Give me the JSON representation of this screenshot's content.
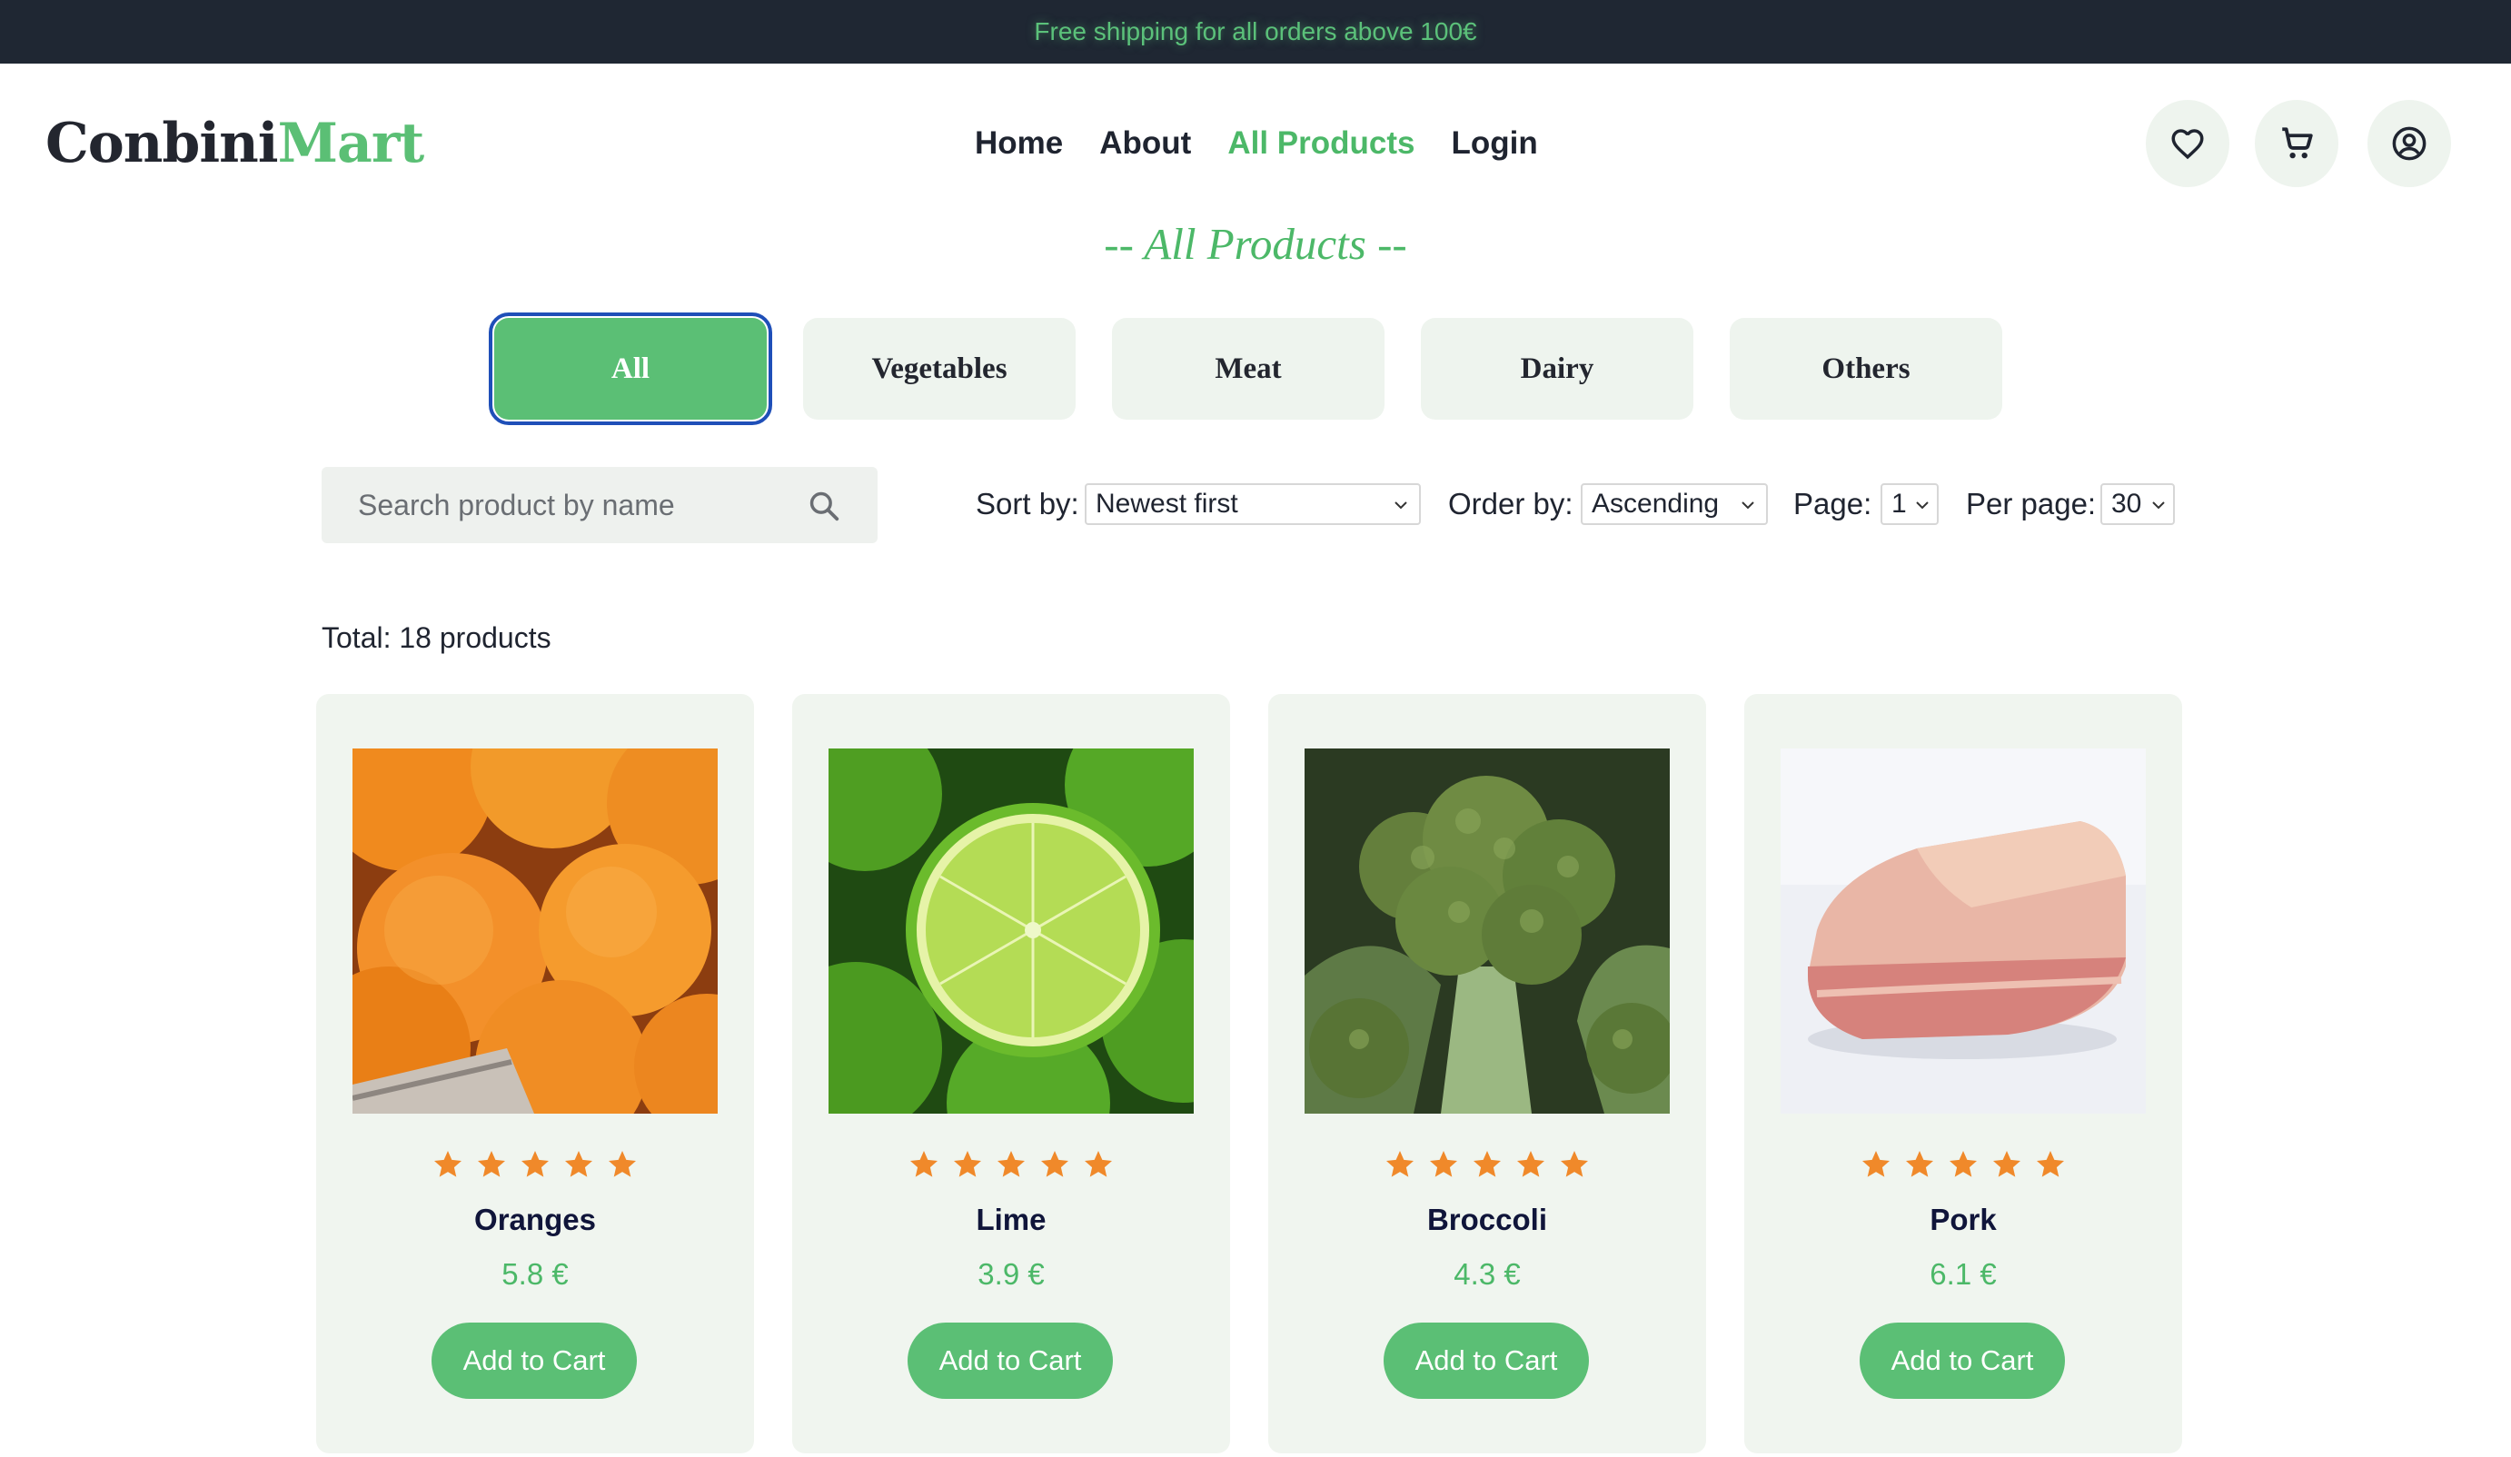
{
  "banner": {
    "text": "Free shipping for all orders above 100€"
  },
  "brand": {
    "part1": "Conbini",
    "part2": "Mart"
  },
  "nav": {
    "items": [
      "Home",
      "About",
      "All Products",
      "Login"
    ],
    "active": "All Products"
  },
  "header_icons": [
    "heart-icon",
    "cart-icon",
    "account-icon"
  ],
  "section_title": "-- All Products --",
  "categories": {
    "items": [
      "All",
      "Vegetables",
      "Meat",
      "Dairy",
      "Others"
    ],
    "active": "All"
  },
  "search": {
    "placeholder": "Search product by name",
    "value": ""
  },
  "controls": {
    "sort_label": "Sort by:",
    "sort_value": "Newest first",
    "order_label": "Order by:",
    "order_value": "Ascending",
    "page_label": "Page:",
    "page_value": "1",
    "per_page_label": "Per page:",
    "per_page_value": "30"
  },
  "total_text": "Total: 18 products",
  "products": [
    {
      "name": "Oranges",
      "price": "5.8 €",
      "rating": 5,
      "button": "Add to Cart",
      "image": "oranges-photo"
    },
    {
      "name": "Lime",
      "price": "3.9 €",
      "rating": 5,
      "button": "Add to Cart",
      "image": "lime-photo"
    },
    {
      "name": "Broccoli",
      "price": "4.3 €",
      "rating": 5,
      "button": "Add to Cart",
      "image": "broccoli-photo"
    },
    {
      "name": "Pork",
      "price": "6.1 €",
      "rating": 5,
      "button": "Add to Cart",
      "image": "pork-photo"
    }
  ],
  "colors": {
    "accent": "#5bbf75",
    "banner_bg": "#1f2733",
    "card_bg": "#f0f5ef",
    "star": "#f0892a",
    "focus": "#1f4fb8"
  }
}
